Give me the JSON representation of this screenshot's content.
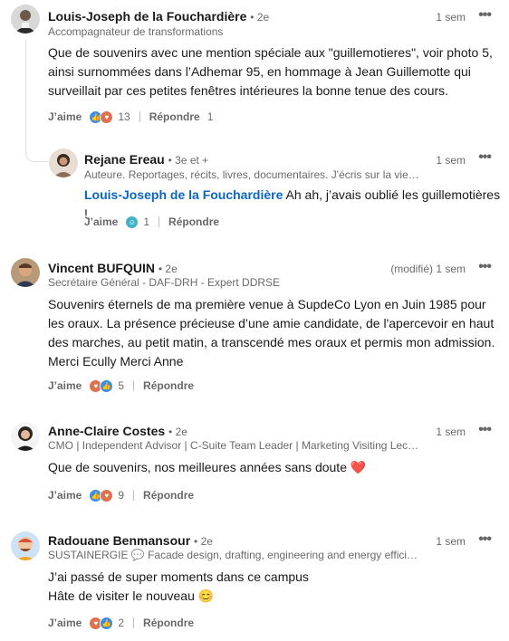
{
  "comments": [
    {
      "name": "Louis-Joseph de la Fouchardière",
      "degree": "• 2e",
      "headline": "Accompagnateur de transformations",
      "time": "1 sem",
      "text": "Que de souvenirs avec une mention spéciale aux \"guillemotieres\", voir photo 5, ainsi surnommées dans l’Adhemar 95, en hommage à Jean Guillemotte qui surveillait par ces petites fenêtres intérieures la bonne tenue des cours.",
      "like_label": "J’aime",
      "reaction_count": "13",
      "reply_label": "Répondre",
      "reply_count": "1",
      "reactions": [
        "like-icon",
        "love-icon"
      ]
    },
    {
      "name": "Rejane Ereau",
      "degree": "• 3e et +",
      "headline": "Auteure. Reportages, récits, livres, documentaires. J'écris sur la vie, le...",
      "time": "1 sem",
      "mention": "Louis-Joseph de la Fouchardière",
      "text": "Ah ah, j’avais oublié les guillemotières !",
      "like_label": "J’aime",
      "reaction_count": "1",
      "reply_label": "Répondre",
      "reactions": [
        "funny-icon"
      ]
    },
    {
      "name": "Vincent BUFQUIN",
      "degree": "• 2e",
      "headline": "Secrétaire Général - DAF-DRH - Expert DDRSE",
      "time": "(modifié) 1 sem",
      "text": "Souvenirs éternels de ma première venue à SupdeCo Lyon en Juin 1985 pour les oraux. La présence précieuse d’une amie candidate, de l'apercevoir en haut des marches, au petit matin, a transcendé mes oraux et permis mon admission. Merci Ecully Merci Anne",
      "like_label": "J’aime",
      "reaction_count": "5",
      "reply_label": "Répondre",
      "reactions": [
        "love-icon",
        "like-icon"
      ]
    },
    {
      "name": "Anne-Claire Costes",
      "degree": "• 2e",
      "headline": "CMO | Independent Advisor | C-Suite Team Leader | Marketing Visiting Lectu...",
      "time": "1 sem",
      "text": "Que de souvenirs, nos meilleures années sans doute ❤️",
      "like_label": "J’aime",
      "reaction_count": "9",
      "reply_label": "Répondre",
      "reactions": [
        "like-icon",
        "love-icon"
      ]
    },
    {
      "name": "Radouane Benmansour",
      "degree": "• 2e",
      "headline": "SUSTAINERGIE 💬 Facade design, drafting, engineering and energy efficient ...",
      "time": "1 sem",
      "text_line1": "J’ai passé de super moments dans ce campus",
      "text_line2": "Hâte de visiter le nouveau 😊",
      "like_label": "J’aime",
      "reaction_count": "2",
      "reply_label": "Répondre",
      "reactions": [
        "love-icon",
        "like-icon"
      ]
    }
  ],
  "more_label": "•••"
}
